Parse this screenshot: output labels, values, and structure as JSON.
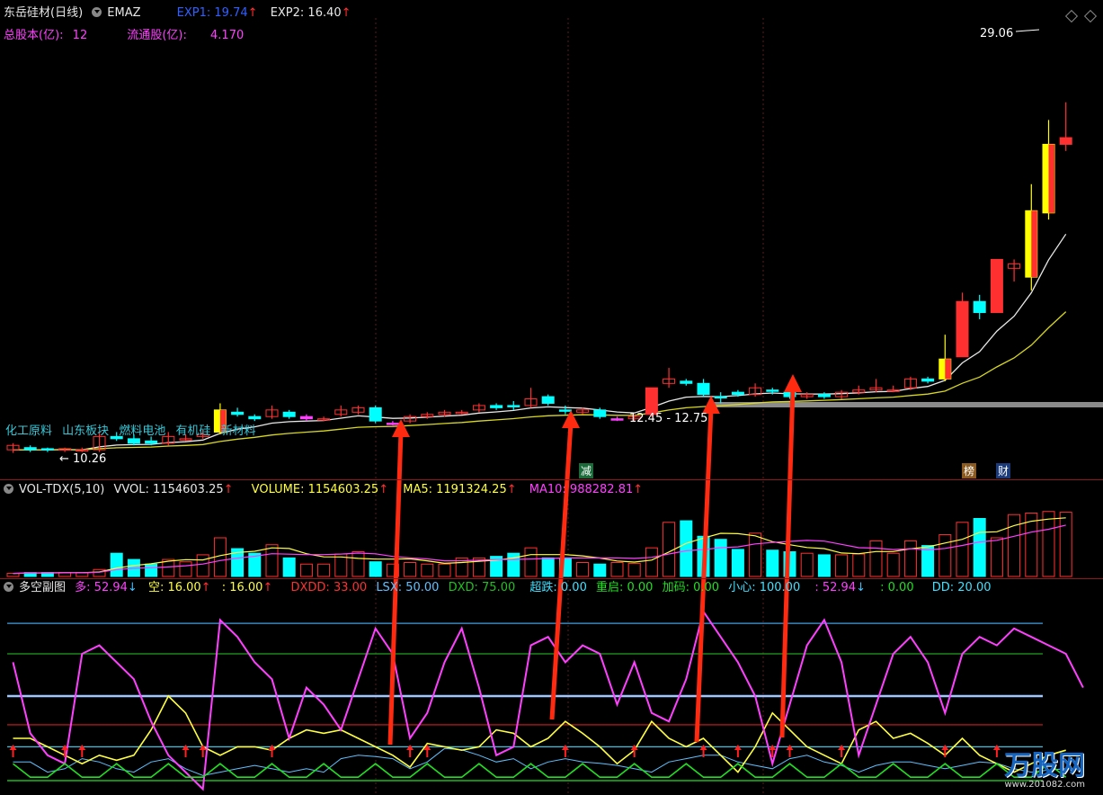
{
  "header": {
    "stock_name": "东岳硅材(日线)",
    "indicator": "EMAZ",
    "exp1_label": "EXP1: 19.74",
    "exp2_label": "EXP2: 16.40",
    "total_shares_label": "总股本(亿):",
    "total_shares_value": "12",
    "float_shares_label": "流通股(亿):",
    "float_shares_value": "4.170"
  },
  "price_panel": {
    "high_label": "29.06",
    "low_label": "10.26",
    "range_label": "12.45 - 12.75",
    "concepts": [
      "化工原料",
      "山东板块",
      "燃料电池",
      "有机硅",
      "新材料"
    ],
    "badge_reduce": "减",
    "badge_rank": "榜",
    "badge_finance": "财"
  },
  "vol_header": {
    "name": "VOL-TDX(5,10)",
    "vvol": "VVOL: 1154603.25",
    "volume": "VOLUME: 1154603.25",
    "ma5": "MA5: 1191324.25",
    "ma10": "MA10: 988282.81"
  },
  "dk_header": {
    "name": "多空副图",
    "duo": "多: 52.94",
    "kong": "空: 16.00",
    "blank1": ": 16.00",
    "dxdd": "DXDD: 33.00",
    "lsx": "LSX: 50.00",
    "dxd": "DXD: 75.00",
    "chaodie": "超跌: 0.00",
    "chongqi": "重启: 0.00",
    "jiama": "加码: 0.00",
    "xiaoxin": "小心: 100.00",
    "blank2": ": 52.94",
    "blank3": ": 0.00",
    "dd": "DD: 20.00"
  },
  "watermark": {
    "brand": "万股网",
    "url": "www.201082.com"
  },
  "colors": {
    "up": "#ff3030",
    "down": "#00ffff",
    "yellow_candle": "#ffff00",
    "ma_white": "#e8e8e8",
    "ma_yellow": "#d8d820",
    "vol_ma5": "#ffff40",
    "vol_ma10": "#ff40ff",
    "dk_magenta": "#ff40ff",
    "dk_yellow": "#ffff40",
    "dk_blue": "#60c0ff",
    "dk_green": "#20e020",
    "arrow": "#ff2a10"
  },
  "chart_data": {
    "type": "candlestick",
    "high_marker": 29.06,
    "low_marker": 10.26,
    "candles": [
      {
        "o": 10.6,
        "c": 10.4,
        "h": 10.7,
        "l": 10.26,
        "s": "up"
      },
      {
        "o": 10.5,
        "c": 10.4,
        "h": 10.6,
        "l": 10.3,
        "s": "dn"
      },
      {
        "o": 10.45,
        "c": 10.4,
        "h": 10.5,
        "l": 10.3,
        "s": "dn"
      },
      {
        "o": 10.4,
        "c": 10.45,
        "h": 10.5,
        "l": 10.3,
        "s": "up"
      },
      {
        "o": 10.4,
        "c": 10.35,
        "h": 10.5,
        "l": 10.3,
        "s": "up"
      },
      {
        "o": 10.4,
        "c": 11.0,
        "h": 11.2,
        "l": 10.3,
        "s": "up"
      },
      {
        "o": 11.0,
        "c": 10.9,
        "h": 11.2,
        "l": 10.8,
        "s": "dn"
      },
      {
        "o": 10.9,
        "c": 10.7,
        "h": 11.1,
        "l": 10.6,
        "s": "dn"
      },
      {
        "o": 10.8,
        "c": 10.7,
        "h": 11.0,
        "l": 10.6,
        "s": "dn"
      },
      {
        "o": 10.7,
        "c": 11.0,
        "h": 11.2,
        "l": 10.6,
        "s": "up"
      },
      {
        "o": 10.9,
        "c": 10.9,
        "h": 11.1,
        "l": 10.8,
        "s": "up"
      },
      {
        "o": 11.0,
        "c": 11.1,
        "h": 11.3,
        "l": 10.9,
        "s": "up"
      },
      {
        "o": 11.2,
        "c": 12.2,
        "h": 12.5,
        "l": 11.1,
        "s": "yel"
      },
      {
        "o": 12.1,
        "c": 12.0,
        "h": 12.3,
        "l": 11.9,
        "s": "dn"
      },
      {
        "o": 11.9,
        "c": 11.8,
        "h": 12.0,
        "l": 11.7,
        "s": "dn"
      },
      {
        "o": 11.9,
        "c": 12.2,
        "h": 12.4,
        "l": 11.8,
        "s": "up"
      },
      {
        "o": 12.1,
        "c": 11.9,
        "h": 12.2,
        "l": 11.8,
        "s": "dn"
      },
      {
        "o": 11.9,
        "c": 11.8,
        "h": 12.0,
        "l": 11.7,
        "s": "mag"
      },
      {
        "o": 11.8,
        "c": 11.8,
        "h": 11.9,
        "l": 11.7,
        "s": "up"
      },
      {
        "o": 12.0,
        "c": 12.2,
        "h": 12.4,
        "l": 11.9,
        "s": "up"
      },
      {
        "o": 12.1,
        "c": 12.3,
        "h": 12.4,
        "l": 12.0,
        "s": "up"
      },
      {
        "o": 12.3,
        "c": 11.7,
        "h": 12.4,
        "l": 11.6,
        "s": "dn"
      },
      {
        "o": 11.6,
        "c": 11.6,
        "h": 11.7,
        "l": 11.5,
        "s": "mag"
      },
      {
        "o": 11.7,
        "c": 11.9,
        "h": 12.0,
        "l": 11.6,
        "s": "up"
      },
      {
        "o": 11.9,
        "c": 12.0,
        "h": 12.1,
        "l": 11.8,
        "s": "up"
      },
      {
        "o": 12.0,
        "c": 12.1,
        "h": 12.2,
        "l": 11.9,
        "s": "up"
      },
      {
        "o": 12.1,
        "c": 12.1,
        "h": 12.2,
        "l": 12.0,
        "s": "up"
      },
      {
        "o": 12.2,
        "c": 12.4,
        "h": 12.5,
        "l": 12.1,
        "s": "up"
      },
      {
        "o": 12.4,
        "c": 12.3,
        "h": 12.5,
        "l": 12.2,
        "s": "dn"
      },
      {
        "o": 12.4,
        "c": 12.4,
        "h": 12.6,
        "l": 12.2,
        "s": "dn"
      },
      {
        "o": 12.4,
        "c": 12.7,
        "h": 13.2,
        "l": 12.3,
        "s": "up"
      },
      {
        "o": 12.8,
        "c": 12.5,
        "h": 12.9,
        "l": 12.4,
        "s": "dn"
      },
      {
        "o": 12.2,
        "c": 12.2,
        "h": 12.4,
        "l": 12.0,
        "s": "dn"
      },
      {
        "o": 12.1,
        "c": 12.2,
        "h": 12.3,
        "l": 12.0,
        "s": "up"
      },
      {
        "o": 12.2,
        "c": 11.9,
        "h": 12.3,
        "l": 11.8,
        "s": "dn"
      },
      {
        "o": 11.8,
        "c": 11.8,
        "h": 11.9,
        "l": 11.7,
        "s": "mag"
      },
      {
        "o": 11.8,
        "c": 11.9,
        "h": 12.0,
        "l": 11.7,
        "s": "up"
      },
      {
        "o": 12.0,
        "c": 13.2,
        "h": 13.2,
        "l": 11.9,
        "s": "red"
      },
      {
        "o": 13.4,
        "c": 13.6,
        "h": 14.1,
        "l": 13.2,
        "s": "up"
      },
      {
        "o": 13.5,
        "c": 13.4,
        "h": 13.6,
        "l": 13.3,
        "s": "dn"
      },
      {
        "o": 13.4,
        "c": 12.9,
        "h": 13.6,
        "l": 12.8,
        "s": "dn"
      },
      {
        "o": 12.8,
        "c": 12.8,
        "h": 13.0,
        "l": 12.5,
        "s": "dn"
      },
      {
        "o": 12.9,
        "c": 13.0,
        "h": 13.1,
        "l": 12.8,
        "s": "dn"
      },
      {
        "o": 12.9,
        "c": 13.2,
        "h": 13.4,
        "l": 12.8,
        "s": "up"
      },
      {
        "o": 13.1,
        "c": 13.1,
        "h": 13.2,
        "l": 12.9,
        "s": "dn"
      },
      {
        "o": 13.0,
        "c": 12.8,
        "h": 13.1,
        "l": 12.7,
        "s": "dn"
      },
      {
        "o": 12.8,
        "c": 12.9,
        "h": 13.0,
        "l": 12.7,
        "s": "up"
      },
      {
        "o": 12.8,
        "c": 12.9,
        "h": 13.0,
        "l": 12.7,
        "s": "dn"
      },
      {
        "o": 12.8,
        "c": 13.0,
        "h": 13.1,
        "l": 12.7,
        "s": "up"
      },
      {
        "o": 13.0,
        "c": 13.1,
        "h": 13.3,
        "l": 12.9,
        "s": "up"
      },
      {
        "o": 13.1,
        "c": 13.2,
        "h": 13.6,
        "l": 13.0,
        "s": "up"
      },
      {
        "o": 13.1,
        "c": 13.1,
        "h": 13.3,
        "l": 13.0,
        "s": "up"
      },
      {
        "o": 13.2,
        "c": 13.6,
        "h": 13.7,
        "l": 13.1,
        "s": "up"
      },
      {
        "o": 13.5,
        "c": 13.6,
        "h": 13.7,
        "l": 13.4,
        "s": "dn"
      },
      {
        "o": 13.6,
        "c": 14.5,
        "h": 15.6,
        "l": 13.5,
        "s": "yel"
      },
      {
        "o": 14.6,
        "c": 17.1,
        "h": 17.5,
        "l": 14.6,
        "s": "red"
      },
      {
        "o": 17.1,
        "c": 16.6,
        "h": 17.4,
        "l": 16.3,
        "s": "dn"
      },
      {
        "o": 16.6,
        "c": 19.0,
        "h": 19.0,
        "l": 16.6,
        "s": "red"
      },
      {
        "o": 18.6,
        "c": 18.8,
        "h": 19.0,
        "l": 18.0,
        "s": "up"
      },
      {
        "o": 18.2,
        "c": 21.2,
        "h": 22.4,
        "l": 17.6,
        "s": "yel"
      },
      {
        "o": 21.1,
        "c": 24.2,
        "h": 25.3,
        "l": 20.8,
        "s": "yel"
      },
      {
        "o": 24.5,
        "c": 24.2,
        "h": 26.1,
        "l": 23.9,
        "s": "red"
      }
    ],
    "volumes": [
      0.04,
      0.05,
      0.05,
      0.05,
      0.05,
      0.09,
      0.3,
      0.22,
      0.16,
      0.22,
      0.19,
      0.28,
      0.5,
      0.36,
      0.3,
      0.41,
      0.24,
      0.16,
      0.16,
      0.29,
      0.32,
      0.19,
      0.16,
      0.18,
      0.16,
      0.16,
      0.24,
      0.24,
      0.26,
      0.3,
      0.37,
      0.24,
      0.24,
      0.18,
      0.16,
      0.18,
      0.17,
      0.37,
      0.7,
      0.72,
      0.52,
      0.48,
      0.35,
      0.56,
      0.34,
      0.32,
      0.3,
      0.28,
      0.28,
      0.29,
      0.46,
      0.3,
      0.46,
      0.4,
      0.54,
      0.7,
      0.75,
      0.5,
      0.8,
      0.82,
      0.84,
      0.83
    ]
  }
}
